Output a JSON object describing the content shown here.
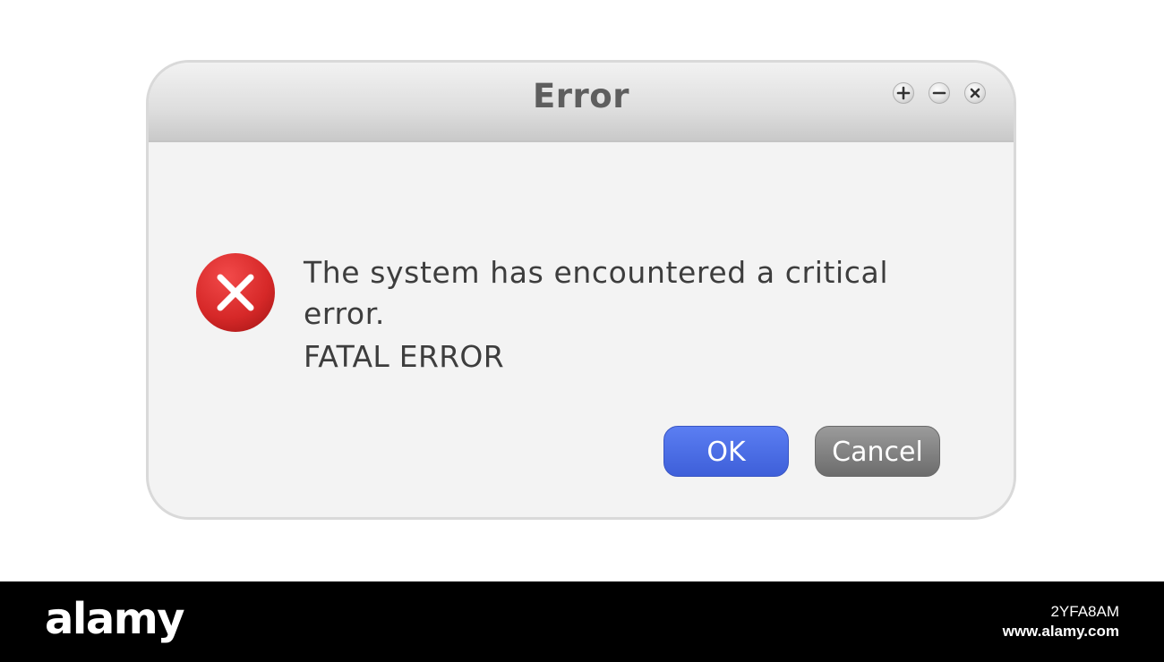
{
  "dialog": {
    "title": "Error",
    "window_controls": {
      "maximize_icon": "plus-icon",
      "minimize_icon": "minus-icon",
      "close_icon": "close-icon"
    },
    "icon": "error-x-icon",
    "message_line1": "The system has encountered a critical",
    "message_line2": "error.",
    "message_line3": "FATAL ERROR",
    "ok_label": "OK",
    "cancel_label": "Cancel"
  },
  "watermark": {
    "logo": "alamy",
    "image_id": "2YFA8AM",
    "site": "www.alamy.com"
  },
  "colors": {
    "ok_button": "#4a6be6",
    "cancel_button": "#7f7f7f",
    "error_icon": "#d42a2a",
    "dialog_background": "#f3f3f3",
    "titlebar": "#d8d8d8",
    "footer": "#000000"
  }
}
